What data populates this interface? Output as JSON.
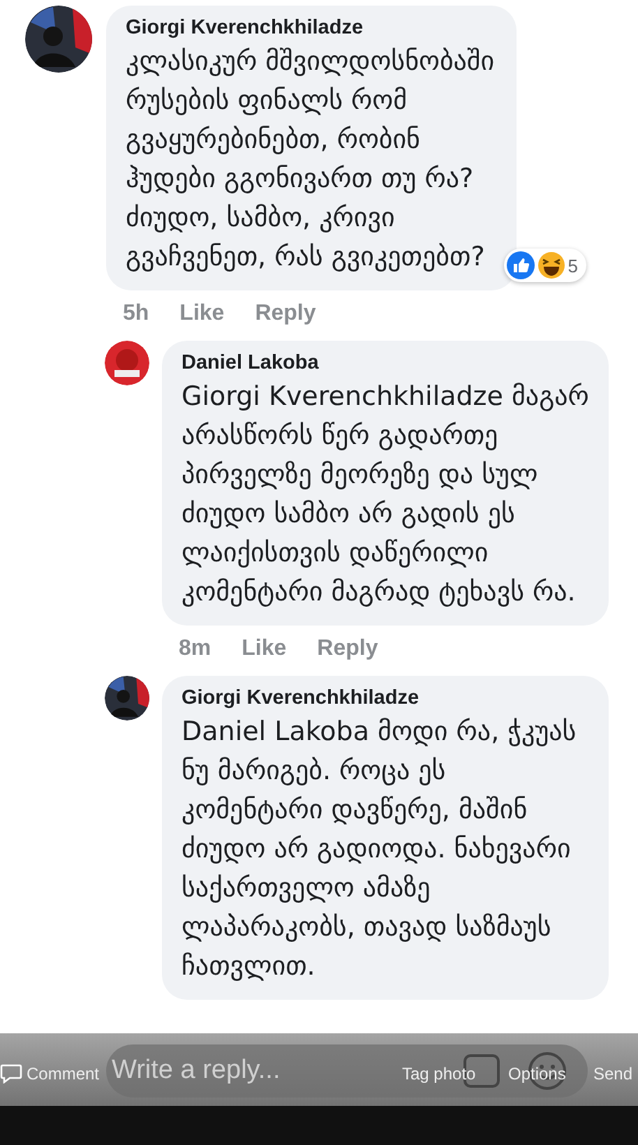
{
  "comments": [
    {
      "author": "Giorgi Kverenchkhiladze",
      "text": "კლასიკურ მშვილდოსნობაში რუსების ფინალს რომ გვაყურებინებთ, რობინ ჰუდები გგონივართ თუ რა? ძიუდო, სამბო, კრივი გვაჩვენეთ, რას გვიკეთებთ?",
      "reactions": {
        "count": "5"
      },
      "time": "5h",
      "like": "Like",
      "reply": "Reply",
      "children": [
        {
          "author": "Daniel Lakoba",
          "text": "Giorgi Kverenchkhiladze მაგარ არასწორს წერ გადართე პირველზე მეორეზე და სულ ძიუდო სამბო არ გადის ეს ლაიქისთვის დაწერილი კომენტარი მაგრად ტეხავს რა.",
          "time": "8m",
          "like": "Like",
          "reply": "Reply"
        },
        {
          "author": "Giorgi Kverenchkhiladze",
          "text": "Daniel Lakoba მოდი რა, ჭკუას ნუ მარიგებ. როცა ეს კომენტარი დავწერე, მაშინ ძიუდო არ გადიოდა. ნახევარი საქართველო ამაზე ლაპარაკობს, თავად საზმაუს ჩათვლით."
        }
      ]
    }
  ],
  "reply_field": {
    "placeholder": "Write a reply..."
  },
  "overlay": {
    "comment": "Comment",
    "tag_photo": "Tag photo",
    "options": "Options",
    "send": "Send"
  }
}
